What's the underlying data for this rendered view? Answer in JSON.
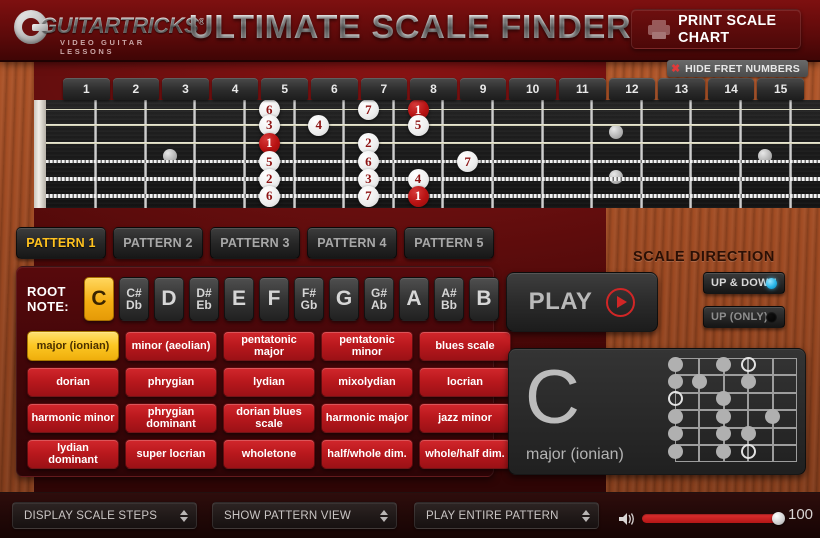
{
  "header": {
    "logo_text": "GUITARTRICKS",
    "logo_reg": "®",
    "logo_sub": "VIDEO GUITAR LESSONS",
    "title": "ULTIMATE SCALE FINDER",
    "print_label": "PRINT SCALE CHART"
  },
  "fretboard": {
    "hide_fret_numbers_label": "HIDE FRET NUMBERS",
    "hide_fret_numbers_x": "✖",
    "fret_numbers": [
      "1",
      "2",
      "3",
      "4",
      "5",
      "6",
      "7",
      "8",
      "9",
      "10",
      "11",
      "12",
      "13",
      "14",
      "15"
    ],
    "string_count": 6,
    "inlays": [
      {
        "fret": 3,
        "double": false
      },
      {
        "fret": 12,
        "double": true
      },
      {
        "fret": 15,
        "double": false
      }
    ],
    "notes": [
      {
        "string": 1,
        "fret": 5,
        "label": "6",
        "root": false
      },
      {
        "string": 2,
        "fret": 5,
        "label": "3",
        "root": false
      },
      {
        "string": 3,
        "fret": 5,
        "label": "1",
        "root": true
      },
      {
        "string": 4,
        "fret": 5,
        "label": "5",
        "root": false
      },
      {
        "string": 5,
        "fret": 5,
        "label": "2",
        "root": false
      },
      {
        "string": 6,
        "fret": 5,
        "label": "6",
        "root": false
      },
      {
        "string": 2,
        "fret": 6,
        "label": "4",
        "root": false
      },
      {
        "string": 1,
        "fret": 7,
        "label": "7",
        "root": false
      },
      {
        "string": 3,
        "fret": 7,
        "label": "2",
        "root": false
      },
      {
        "string": 4,
        "fret": 7,
        "label": "6",
        "root": false
      },
      {
        "string": 5,
        "fret": 7,
        "label": "3",
        "root": false
      },
      {
        "string": 6,
        "fret": 7,
        "label": "7",
        "root": false
      },
      {
        "string": 1,
        "fret": 8,
        "label": "1",
        "root": true
      },
      {
        "string": 2,
        "fret": 8,
        "label": "5",
        "root": false
      },
      {
        "string": 5,
        "fret": 8,
        "label": "4",
        "root": false
      },
      {
        "string": 6,
        "fret": 8,
        "label": "1",
        "root": true
      },
      {
        "string": 4,
        "fret": 9,
        "label": "7",
        "root": false
      }
    ]
  },
  "patterns": [
    {
      "label": "PATTERN 1",
      "active": true
    },
    {
      "label": "PATTERN 2",
      "active": false
    },
    {
      "label": "PATTERN 3",
      "active": false
    },
    {
      "label": "PATTERN 4",
      "active": false
    },
    {
      "label": "PATTERN 5",
      "active": false
    }
  ],
  "root_note": {
    "label_line1": "ROOT",
    "label_line2": "NOTE:",
    "selected": "C",
    "options": [
      {
        "main": "C",
        "alt": "",
        "active": true
      },
      {
        "main": "C#",
        "alt": "Db",
        "active": false
      },
      {
        "main": "D",
        "alt": "",
        "active": false
      },
      {
        "main": "D#",
        "alt": "Eb",
        "active": false
      },
      {
        "main": "E",
        "alt": "",
        "active": false
      },
      {
        "main": "F",
        "alt": "",
        "active": false
      },
      {
        "main": "F#",
        "alt": "Gb",
        "active": false
      },
      {
        "main": "G",
        "alt": "",
        "active": false
      },
      {
        "main": "G#",
        "alt": "Ab",
        "active": false
      },
      {
        "main": "A",
        "alt": "",
        "active": false
      },
      {
        "main": "A#",
        "alt": "Bb",
        "active": false
      },
      {
        "main": "B",
        "alt": "",
        "active": false
      }
    ]
  },
  "scales": [
    {
      "label": "major (ionian)",
      "active": true
    },
    {
      "label": "minor (aeolian)",
      "active": false
    },
    {
      "label": "pentatonic major",
      "active": false
    },
    {
      "label": "pentatonic minor",
      "active": false
    },
    {
      "label": "blues scale",
      "active": false
    },
    {
      "label": "dorian",
      "active": false
    },
    {
      "label": "phrygian",
      "active": false
    },
    {
      "label": "lydian",
      "active": false
    },
    {
      "label": "mixolydian",
      "active": false
    },
    {
      "label": "locrian",
      "active": false
    },
    {
      "label": "harmonic minor",
      "active": false
    },
    {
      "label": "phrygian dominant",
      "active": false
    },
    {
      "label": "dorian blues scale",
      "active": false
    },
    {
      "label": "harmonic major",
      "active": false
    },
    {
      "label": "jazz minor",
      "active": false
    },
    {
      "label": "lydian dominant",
      "active": false
    },
    {
      "label": "super locrian",
      "active": false
    },
    {
      "label": "wholetone",
      "active": false
    },
    {
      "label": "half/whole dim.",
      "active": false
    },
    {
      "label": "whole/half dim.",
      "active": false
    }
  ],
  "play": {
    "label": "PLAY"
  },
  "scale_direction": {
    "title": "SCALE DIRECTION",
    "options": [
      {
        "label": "UP & DOWN",
        "selected": true
      },
      {
        "label": "UP (ONLY)",
        "selected": false
      }
    ]
  },
  "scale_display": {
    "root": "C",
    "type": "major (ionian)",
    "diagram_dots": [
      {
        "string": 1,
        "fret": 1,
        "open": false
      },
      {
        "string": 1,
        "fret": 3,
        "open": false
      },
      {
        "string": 1,
        "fret": 4,
        "open": true
      },
      {
        "string": 2,
        "fret": 1,
        "open": false
      },
      {
        "string": 2,
        "fret": 2,
        "open": false
      },
      {
        "string": 2,
        "fret": 4,
        "open": false
      },
      {
        "string": 3,
        "fret": 1,
        "open": true
      },
      {
        "string": 3,
        "fret": 3,
        "open": false
      },
      {
        "string": 4,
        "fret": 1,
        "open": false
      },
      {
        "string": 4,
        "fret": 3,
        "open": false
      },
      {
        "string": 4,
        "fret": 5,
        "open": false
      },
      {
        "string": 5,
        "fret": 1,
        "open": false
      },
      {
        "string": 5,
        "fret": 3,
        "open": false
      },
      {
        "string": 5,
        "fret": 4,
        "open": false
      },
      {
        "string": 6,
        "fret": 1,
        "open": false
      },
      {
        "string": 6,
        "fret": 3,
        "open": false
      },
      {
        "string": 6,
        "fret": 4,
        "open": true
      }
    ]
  },
  "bottom_bar": {
    "display_mode": "DISPLAY SCALE STEPS",
    "view_mode": "SHOW PATTERN VIEW",
    "playback_mode": "PLAY ENTIRE PATTERN",
    "volume_value": "100",
    "volume_percent": 100
  },
  "colors": {
    "accent_red": "#b81214",
    "highlight_yellow": "#fcc723",
    "root_note_red": "#b81212",
    "led_blue": "#29b6e8"
  }
}
